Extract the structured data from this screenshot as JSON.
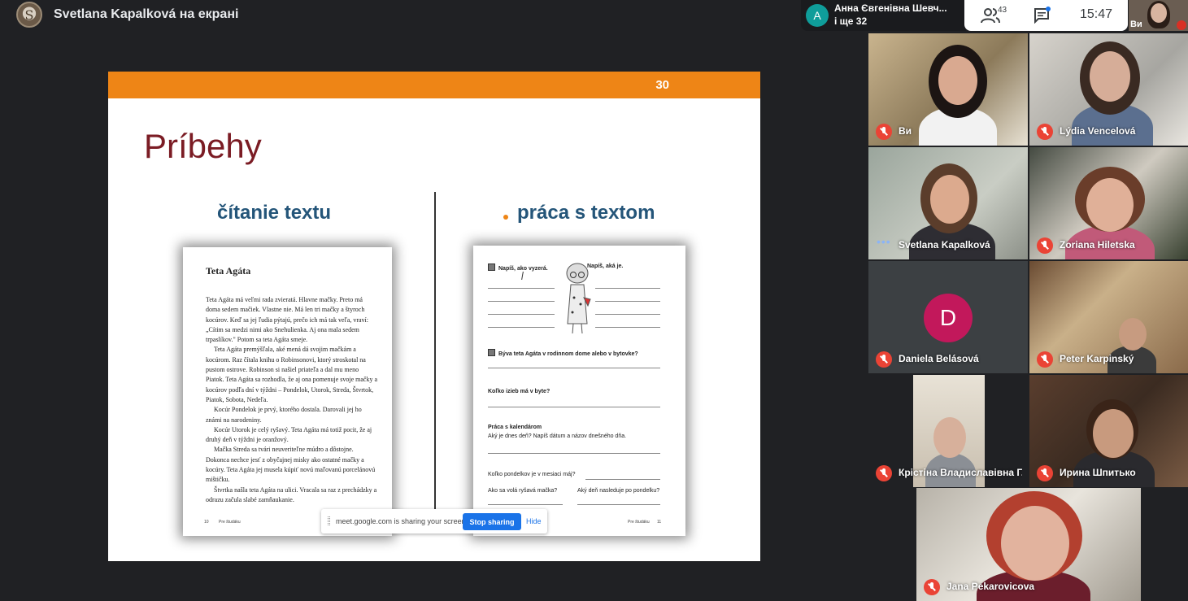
{
  "meeting": {
    "presenter_title": "Svetlana Kapalková на екрані",
    "presenter_initial": "S"
  },
  "notification": {
    "initial": "A",
    "name": "Анна Євгенівна Шевч...",
    "subtitle": "і ще 32"
  },
  "toolbar": {
    "participants_count": "43",
    "time": "15:47",
    "self_label": "Ви"
  },
  "slide": {
    "page_number": "30",
    "title": "Príbehy",
    "left_heading": "čítanie textu",
    "right_heading": "práca s textom",
    "book_left": {
      "story_title": "Teta Agáta",
      "paragraphs": [
        "Teta Agáta má veľmi rada zvieratá. Hlavne mačky. Preto má doma sedem mačiek. Vlastne nie. Má len tri mačky a štyroch kocúrov. Keď sa jej ľudia pýtajú, prečo ich má tak veľa, vraví: „Cítim sa medzi nimi ako Snehulienka. Aj ona mala sedem trpaslíkov.\" Potom sa teta Agáta smeje.",
        "Teta Agáta premýšľala, aké mená dá svojim mačkám a kocúrom. Raz čítala knihu o Robinsonovi, ktorý stroskotal na pustom ostrove. Robinson si našiel priateľa a dal mu meno Piatok. Teta Agáta sa rozhodla, že aj ona pomenuje svoje mačky a kocúrov podľa dní v týždni – Pondelok, Utorok, Streda, Štvrtok, Piatok, Sobota, Nedeľa.",
        "Kocúr Pondelok je prvý, ktorého dostala. Darovali jej ho známi na narodeniny.",
        "Kocúr Utorok je celý ryšavý. Teta Agáta má totiž pocit, že aj druhý deň v týždni je oranžový.",
        "Mačka Streda sa tvári neuveriteľne múdro a dôstojne. Dokonca nechce jesť z obyčajnej misky ako ostatné mačky a kocúry. Teta Agáta jej musela kúpiť novú maľovanú porcelánovú mištičku.",
        "Štvrtka našla teta Agáta na ulici. Vracala sa raz z prechádzky a odrazu začula slabé zamňaukanie."
      ],
      "footer_page": "10",
      "footer_label": "Pre študáku"
    },
    "book_right": {
      "task1_a": "Napíš, ako vyzerá.",
      "task1_b": "Napíš, aká je.",
      "task2": "Býva teta Agáta v rodinnom dome alebo v bytovke?",
      "task3": "Koľko izieb má v byte?",
      "task4_title": "Práca s kalendárom",
      "task4_text": "Aký je dnes deň? Napíš dátum a názov dnešného dňa.",
      "task5": "Koľko pondelkov je v mesiaci máj?",
      "task6_a": "Ako sa volá ryšavá mačka?",
      "task6_b": "Aký deň nasleduje po pondelku?",
      "footer_label": "Pre študáku",
      "footer_page": "11"
    }
  },
  "share_bar": {
    "message": "meet.google.com is sharing your screen.",
    "stop_label": "Stop sharing",
    "hide_label": "Hide"
  },
  "participants": [
    {
      "name": "Ви",
      "muted": true
    },
    {
      "name": "Lýdia Vencelová",
      "muted": true
    },
    {
      "name": "Svetlana Kapalková",
      "muted": false
    },
    {
      "name": "Zoriana Hiletska",
      "muted": true
    },
    {
      "name": "Daniela Belásová",
      "muted": true,
      "initial": "D",
      "avatar_color": "#c2185b"
    },
    {
      "name": "Peter Karpinský",
      "muted": true
    },
    {
      "name": "Крістіна Владиславівна Г...",
      "muted": true
    },
    {
      "name": "Ирина Шпитько",
      "muted": true
    },
    {
      "name": "Jana Pekarovicova",
      "muted": true
    }
  ],
  "colors": {
    "slide_bar": "#ee8516",
    "slide_title": "#7b1c24",
    "heading": "#245579",
    "stop_button": "#1a73e8",
    "muted_mic": "#ea4335"
  }
}
